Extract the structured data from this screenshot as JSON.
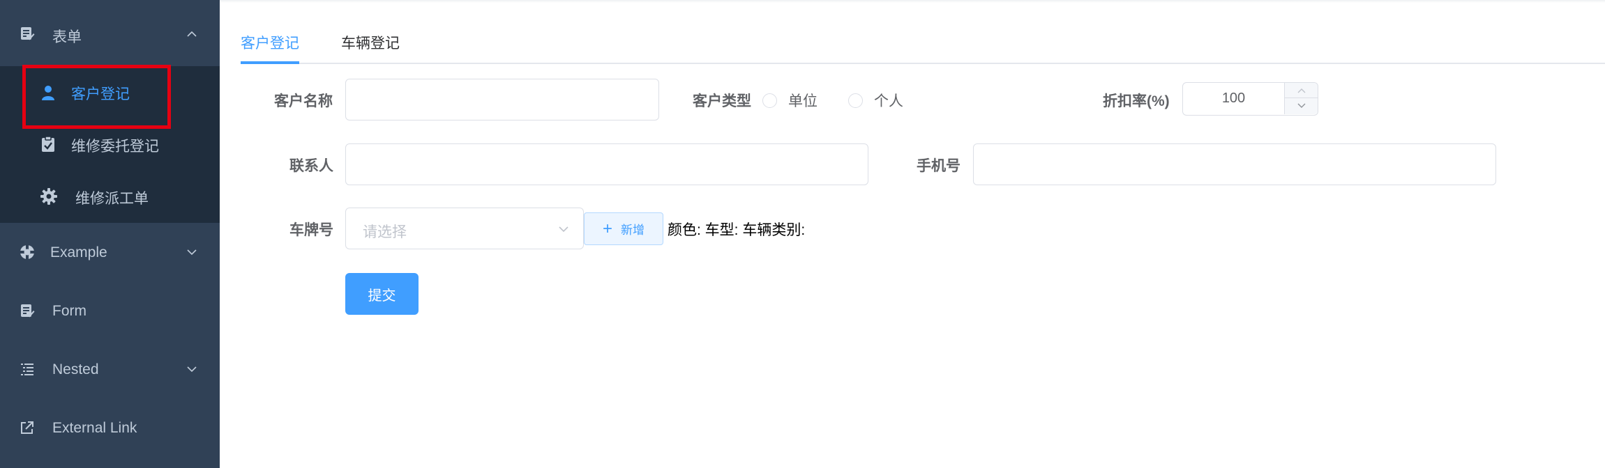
{
  "sidebar": {
    "form_group": {
      "label": "表单",
      "icon": "form-icon",
      "expand_icon": "chevron-up-icon"
    },
    "submenu": [
      {
        "label": "客户登记",
        "icon": "user-icon",
        "active": true
      },
      {
        "label": "维修委托登记",
        "icon": "clipboard-check-icon",
        "active": false
      },
      {
        "label": "维修派工单",
        "icon": "gear-icon",
        "active": false
      }
    ],
    "items": [
      {
        "label": "Example",
        "icon": "example-icon",
        "expand_icon": "chevron-down-icon"
      },
      {
        "label": "Form",
        "icon": "form-icon"
      },
      {
        "label": "Nested",
        "icon": "nested-list-icon",
        "expand_icon": "chevron-down-icon"
      },
      {
        "label": "External Link",
        "icon": "external-link-icon"
      }
    ]
  },
  "tabs": [
    {
      "label": "客户登记",
      "active": true
    },
    {
      "label": "车辆登记",
      "active": false
    }
  ],
  "form": {
    "customer_name_label": "客户名称",
    "customer_name_value": "",
    "customer_type_label": "客户类型",
    "customer_type_options": [
      "单位",
      "个人"
    ],
    "discount_label": "折扣率(%)",
    "discount_value": "100",
    "contact_label": "联系人",
    "contact_value": "",
    "phone_label": "手机号",
    "phone_value": "",
    "plate_label": "车牌号",
    "plate_placeholder": "请选择",
    "add_button_label": "新增",
    "vehicle_info": "颜色: 车型: 车辆类别:",
    "submit_label": "提交"
  },
  "colors": {
    "sidebar_bg": "#304156",
    "submenu_bg": "#1f2d3d",
    "accent": "#409eff",
    "sidebar_text": "#bfcbd9",
    "highlight": "#e60012"
  }
}
